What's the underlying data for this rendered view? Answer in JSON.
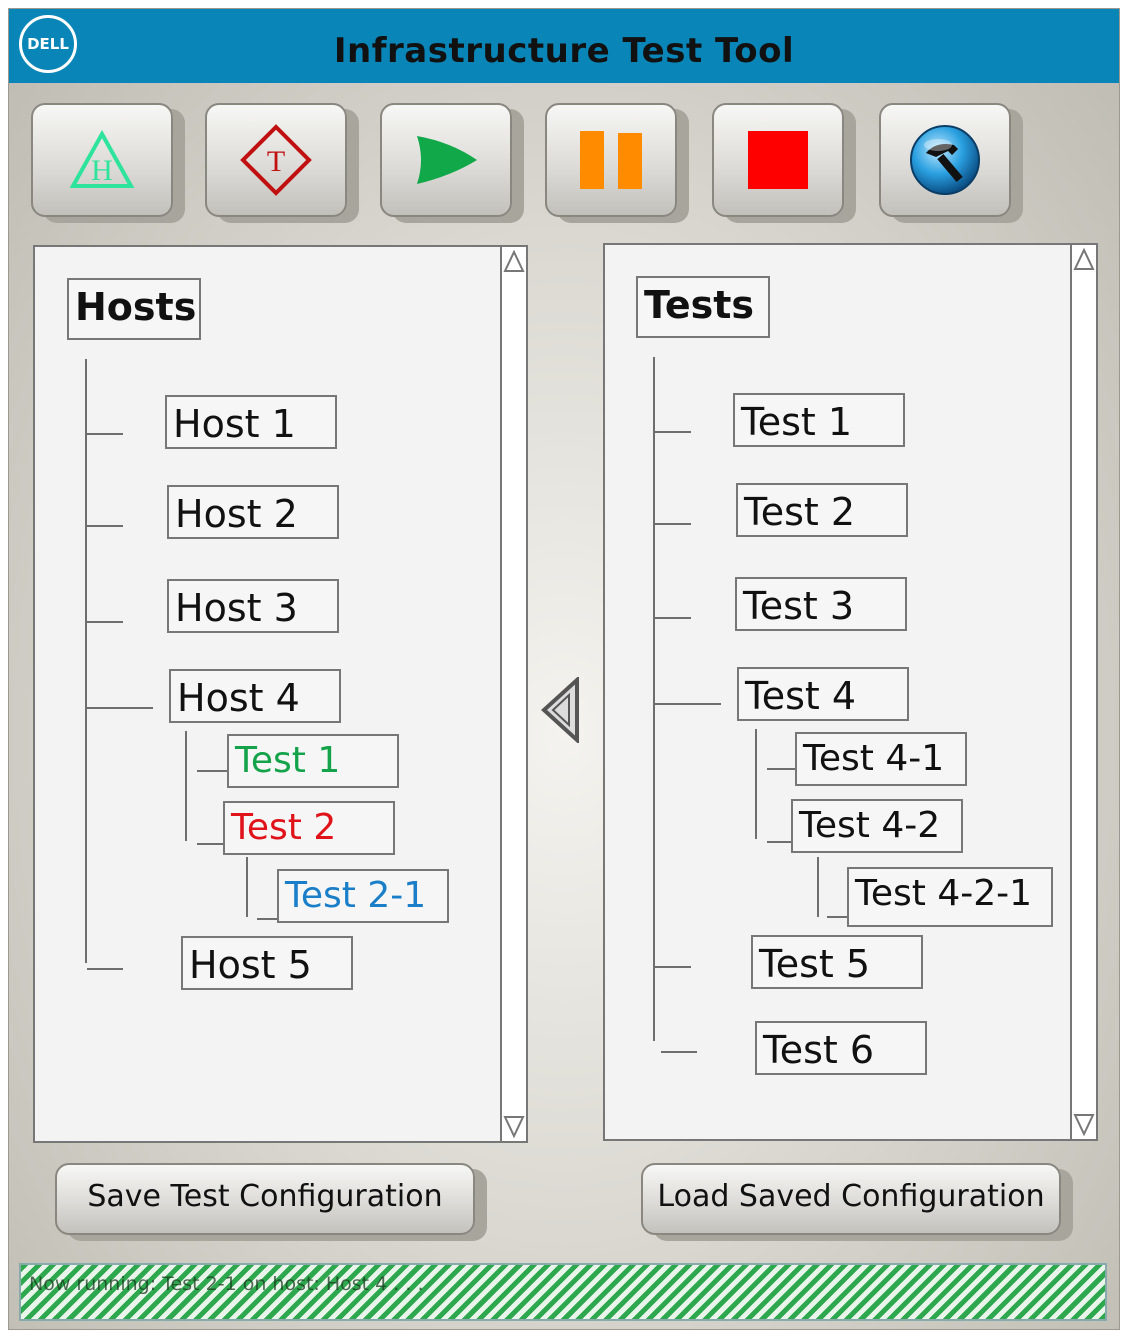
{
  "app": {
    "logo_text": "DELL",
    "title": "Infrastructure Test Tool"
  },
  "toolbar": {
    "buttons": [
      {
        "name": "add-host",
        "icon": "host-triangle-icon",
        "glyph": "H",
        "color": "#2ee39b"
      },
      {
        "name": "add-test",
        "icon": "test-diamond-icon",
        "glyph": "T",
        "color": "#c01010"
      },
      {
        "name": "run",
        "icon": "play-icon",
        "color": "#11a84a"
      },
      {
        "name": "pause",
        "icon": "pause-icon",
        "color": "#ff8c00"
      },
      {
        "name": "stop",
        "icon": "stop-icon",
        "color": "#ff0000"
      },
      {
        "name": "settings",
        "icon": "hammer-icon",
        "color": "#2aa0e0"
      }
    ]
  },
  "hosts_panel": {
    "header": "Hosts",
    "hosts": [
      "Host 1",
      "Host 2",
      "Host 3",
      "Host 4",
      "Host 5"
    ],
    "host4_children": [
      {
        "label": "Test 1",
        "color": "#14a34a"
      },
      {
        "label": "Test 2",
        "color": "#e0131a"
      },
      {
        "label": "Test 2-1",
        "color": "#1a7fc8"
      }
    ]
  },
  "tests_panel": {
    "header": "Tests",
    "tests": [
      "Test 1",
      "Test 2",
      "Test 3",
      "Test 4",
      "Test 5",
      "Test 6"
    ],
    "test4_children": [
      "Test 4-1",
      "Test 4-2",
      "Test 4-2-1"
    ]
  },
  "actions": {
    "save_label": "Save Test Configuration",
    "load_label": "Load Saved Configuration"
  },
  "status": {
    "text": "Now running: Test 2-1 on host: Host 4 . . ."
  }
}
